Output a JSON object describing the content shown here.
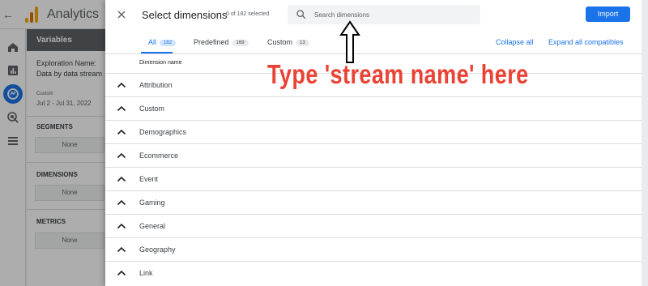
{
  "app": {
    "name": "Analytics",
    "variables_panel": {
      "header": "Variables",
      "exploration_name_label": "Exploration Name:",
      "exploration_name_value": "Data by data stream",
      "date_badge": "Custom",
      "date_range": "Jul 2 - Jul 31, 2022",
      "segments_label": "SEGMENTS",
      "segments_value": "None",
      "dimensions_label": "DIMENSIONS",
      "dimensions_value": "None",
      "metrics_label": "METRICS",
      "metrics_value": "None"
    }
  },
  "dialog": {
    "title": "Select dimensions",
    "selected_count": "0 of 182 selected",
    "search_placeholder": "Search dimensions",
    "import_label": "Import",
    "tabs": [
      {
        "label": "All",
        "count": "182",
        "active": true
      },
      {
        "label": "Predefined",
        "count": "169",
        "active": false
      },
      {
        "label": "Custom",
        "count": "13",
        "active": false
      }
    ],
    "collapse_all_label": "Collapse all",
    "expand_all_label": "Expand all compatibles",
    "column_header": "Dimension name",
    "rows": [
      {
        "label": "Attribution"
      },
      {
        "label": "Custom"
      },
      {
        "label": "Demographics"
      },
      {
        "label": "Ecommerce"
      },
      {
        "label": "Event"
      },
      {
        "label": "Gaming"
      },
      {
        "label": "General"
      },
      {
        "label": "Geography"
      },
      {
        "label": "Link"
      }
    ]
  },
  "annotation": {
    "text": "Type 'stream name' here",
    "color": "#ea4335"
  },
  "colors": {
    "accent": "#1a73e8",
    "annotation": "#ea4335"
  }
}
